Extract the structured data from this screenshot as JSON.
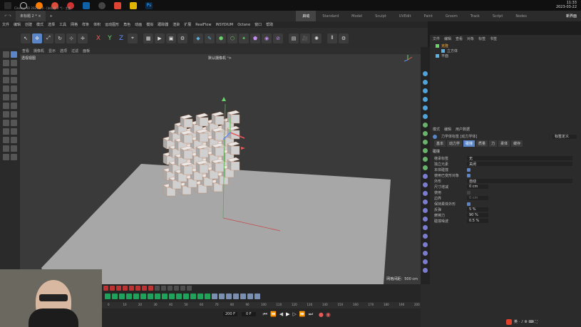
{
  "taskbar": {
    "time": "11:33",
    "date": "2023-03-22"
  },
  "titlebar": {
    "app_title": "Cinema 4D 2023.1.0 - [未标题 2 *] - 主要",
    "doc_tab": "未标题 2 *",
    "workspaces": [
      "启动",
      "Standard",
      "Model",
      "Sculpt",
      "UVEdit",
      "Paint",
      "Groom",
      "Track",
      "Script",
      "Nodes"
    ],
    "active_workspace": "启动",
    "new_ui": "新界面"
  },
  "menubar": {
    "items": [
      "文件",
      "编辑",
      "创建",
      "模式",
      "选择",
      "工具",
      "网格",
      "样条",
      "体积",
      "运动图形",
      "角色",
      "动画",
      "模拟",
      "跟踪器",
      "渲染",
      "扩展",
      "RealFlow",
      "INSYDIUM",
      "Octane",
      "窗口",
      "帮助"
    ]
  },
  "viewport": {
    "menu_items": [
      "查看",
      "摄像机",
      "显示",
      "选项",
      "过滤",
      "面板"
    ],
    "label": "透视视图",
    "camera": "默认摄像机 ᵒ>",
    "grid_info": "网格间距：500 cm",
    "axis_labels": [
      "X",
      "Y",
      "Z"
    ]
  },
  "object_manager": {
    "menu_items": [
      "文件",
      "编辑",
      "查看",
      "对象",
      "标签",
      "书签"
    ],
    "objects": [
      {
        "name": "克隆",
        "selected": true
      },
      {
        "name": "立方体",
        "selected": false
      },
      {
        "name": "平面",
        "selected": false
      }
    ]
  },
  "attribute_manager": {
    "menu_items": [
      "模式",
      "编辑",
      "用户数据"
    ],
    "tag_title": "力学体标签 [动力学体]",
    "dropdown": "标签定义",
    "tabs": [
      "基本",
      "动力学",
      "碰撞",
      "质量",
      "力",
      "柔体",
      "缓存"
    ],
    "active_tab": "碰撞",
    "section": "碰撞",
    "rows": [
      {
        "label": "继承标签",
        "value": "无",
        "type": "dropdown"
      },
      {
        "label": "独立元素",
        "value": "关闭",
        "type": "dropdown"
      },
      {
        "label": "本体碰撞",
        "value": "",
        "type": "check"
      },
      {
        "label": "使用已变形对象",
        "value": "",
        "type": "check"
      },
      {
        "label": "外形",
        "value": "自动",
        "type": "dropdown"
      },
      {
        "label": "尺寸增减",
        "value": "0 cm",
        "type": "field"
      },
      {
        "label": "使用",
        "value": "",
        "type": "check-off"
      },
      {
        "label": "边界",
        "value": "0 cm",
        "type": "field-dim"
      },
      {
        "label": "保持柔体外形",
        "value": "",
        "type": "check"
      },
      {
        "label": "反弹",
        "value": "5 %",
        "type": "field"
      },
      {
        "label": "摩擦力",
        "value": "90 %",
        "type": "field"
      },
      {
        "label": "碰撞噪波",
        "value": "0.5 %",
        "type": "field"
      }
    ]
  },
  "timeline": {
    "ruler_ticks": [
      "0",
      "10",
      "20",
      "30",
      "40",
      "50",
      "60",
      "70",
      "80",
      "90",
      "100",
      "110",
      "120",
      "130",
      "140",
      "150",
      "160",
      "170",
      "180",
      "190",
      "200"
    ],
    "current_frame": "0 F",
    "end_frame": "200 F",
    "frame_field": "0 F"
  },
  "colors": {
    "accent": "#5a86c9",
    "selected_object": "#f2a93b",
    "x_axis": "#e65a5a",
    "y_axis": "#6ad46a",
    "z_axis": "#5d8cff"
  }
}
